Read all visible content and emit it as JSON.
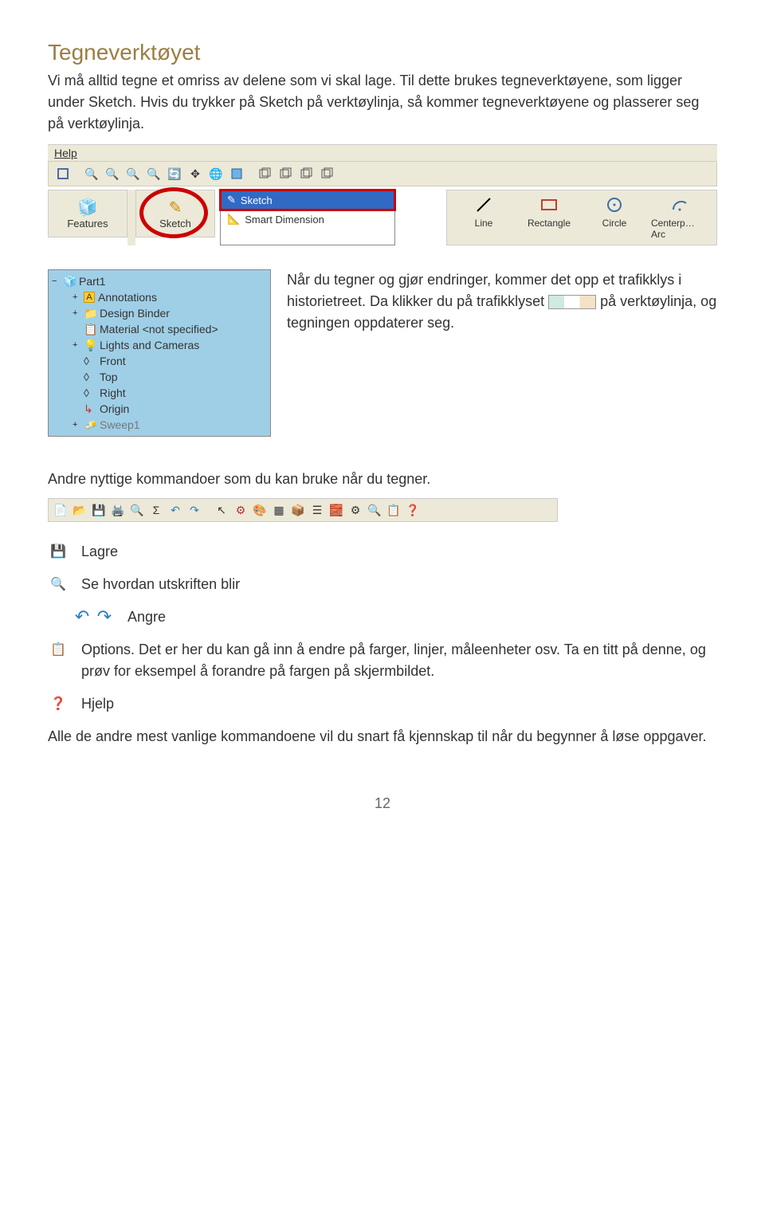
{
  "title": "Tegneverktøyet",
  "intro_p1": "Vi må alltid tegne et omriss av delene som vi skal lage. Til dette brukes tegneverktøyene, som ligger under Sketch. Hvis du trykker på Sketch på verktøylinja, så kommer tegneverktøyene og plasserer seg på verktøylinja.",
  "menu": {
    "help": "Help"
  },
  "tabbtns": {
    "features": "Features",
    "sketch": "Sketch"
  },
  "sketch_menu": {
    "sketch": "Sketch",
    "smart": "Smart Dimension"
  },
  "sketch_tools": {
    "line": "Line",
    "rectangle": "Rectangle",
    "circle": "Circle",
    "centerarc": "Centerp… Arc"
  },
  "tree": {
    "part": "Part1",
    "annotations": "Annotations",
    "design_binder": "Design Binder",
    "material": "Material <not specified>",
    "lights": "Lights and Cameras",
    "front": "Front",
    "top": "Top",
    "right": "Right",
    "origin": "Origin",
    "sweep": "Sweep1"
  },
  "mid": {
    "p1": "Når du tegner og gjør endringer, kommer det opp et trafikklys i historietreet. Da klikker du på trafikklyset ",
    "p2": " på verktøylinja, og tegningen oppdaterer seg."
  },
  "cmds_heading": "Andre nyttige kommandoer som du kan bruke når du tegner.",
  "actions": {
    "save": "Lagre",
    "preview": "Se hvordan utskriften blir",
    "undo": "Angre",
    "options": "Options. Det er her du kan gå inn å endre på farger, linjer, måleenheter osv. Ta en titt på denne, og prøv for eksempel å forandre på fargen på skjermbildet.",
    "help": "Hjelp"
  },
  "closing": "Alle de andre mest vanlige kommandoene vil du snart få kjennskap til når du begynner å løse oppgaver.",
  "page_num": "12"
}
